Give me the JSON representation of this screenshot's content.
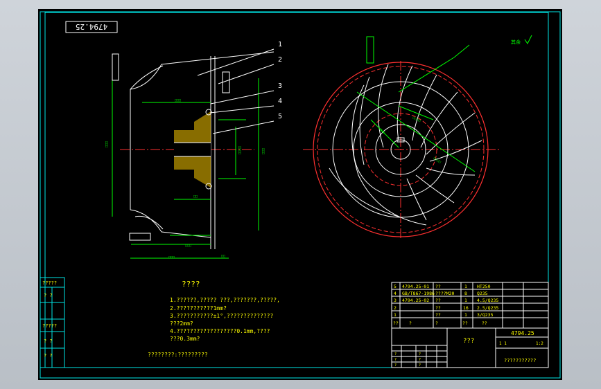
{
  "drawing": {
    "number_stamp": "4794.25",
    "roughness_mark": "其余",
    "callouts": [
      "1",
      "2",
      "3",
      "4",
      "5"
    ]
  },
  "notes": {
    "title": "????",
    "lines": [
      "1.??????,?????      ???,???????,?????,",
      "2.???????????1mm?",
      "3.???????????±1°,??????????????",
      "  ???2mm?",
      "4.??????????????????0.1mm,????",
      "  ???0.3mm?"
    ],
    "footer": "????????:?????????"
  },
  "left_stamp": [
    "?????",
    "?  ?",
    "?????",
    "?  ?",
    "?  ?"
  ],
  "bom": {
    "rows": [
      {
        "no": "5",
        "code": "4794.25-01",
        "name": "??",
        "qty": "1",
        "mat": "HT250"
      },
      {
        "no": "4",
        "code": "GB/T867-1986",
        "name": "????M20",
        "qty": "8",
        "mat": "Q235"
      },
      {
        "no": "3",
        "code": "4794.25-02",
        "name": "??",
        "qty": "1",
        "mat": "4.5/Q235"
      },
      {
        "no": "2",
        "code": "",
        "name": "??",
        "qty": "16",
        "mat": "2.5/Q235"
      },
      {
        "no": "1",
        "code": "",
        "name": "??",
        "qty": "1",
        "mat": "3/Q235"
      }
    ],
    "header": [
      "??",
      "?",
      "?",
      "??",
      "??"
    ]
  },
  "title_block": {
    "part_name": "???",
    "drawing_no": "4794.25",
    "scale": "1:2",
    "sheet": "1  1",
    "company": "???????????",
    "small_cells": [
      "?",
      "?",
      "?",
      "?",
      "?",
      "?"
    ]
  },
  "colors": {
    "background": "#000000",
    "border": "#00ffff",
    "dimension": "#00ff00",
    "outline": "#ffffff",
    "center": "#ff0000",
    "text": "#ffff00",
    "hatch": "#ffff00"
  }
}
